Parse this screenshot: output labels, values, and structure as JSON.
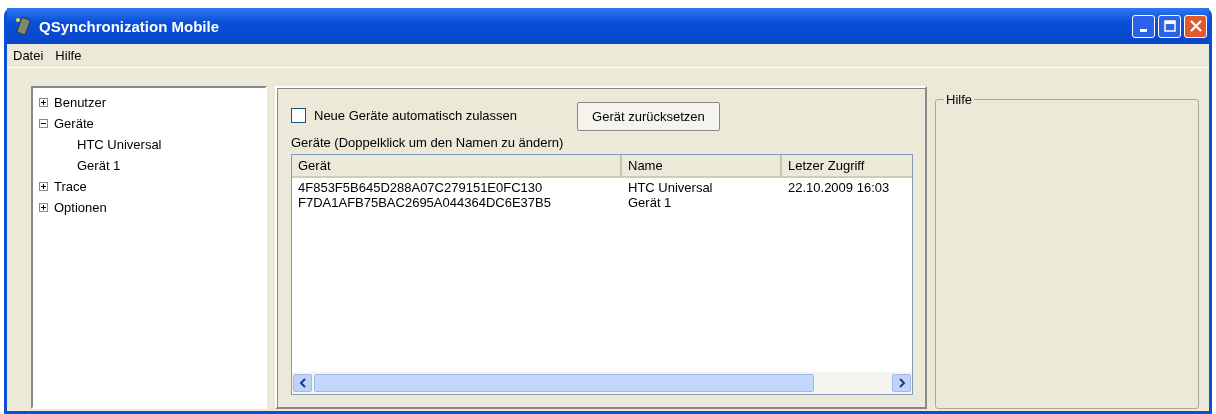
{
  "window": {
    "title": "QSynchronization Mobile"
  },
  "menu": [
    "Datei",
    "Hilfe"
  ],
  "tree": [
    {
      "label": "Benutzer",
      "expanded": false
    },
    {
      "label": "Geräte",
      "expanded": true,
      "children": [
        {
          "label": "HTC Universal"
        },
        {
          "label": "Gerät 1"
        }
      ]
    },
    {
      "label": "Trace",
      "expanded": false
    },
    {
      "label": "Optionen",
      "expanded": false
    }
  ],
  "auto_accept": {
    "label": "Neue Geräte automatisch zulassen",
    "checked": false
  },
  "reset_button": "Gerät zurücksetzen",
  "table_caption": "Geräte (Doppelklick um den Namen zu ändern)",
  "table": {
    "columns": [
      "Gerät",
      "Name",
      "Letzer Zugriff"
    ],
    "rows": [
      [
        "4F853F5B645D288A07C279151E0FC130",
        "HTC Universal",
        "22.10.2009 16:03"
      ],
      [
        "F7DA1AFB75BAC2695A044364DC6E37B5",
        "Gerät 1",
        ""
      ]
    ]
  },
  "help_group": {
    "title": "Hilfe"
  }
}
